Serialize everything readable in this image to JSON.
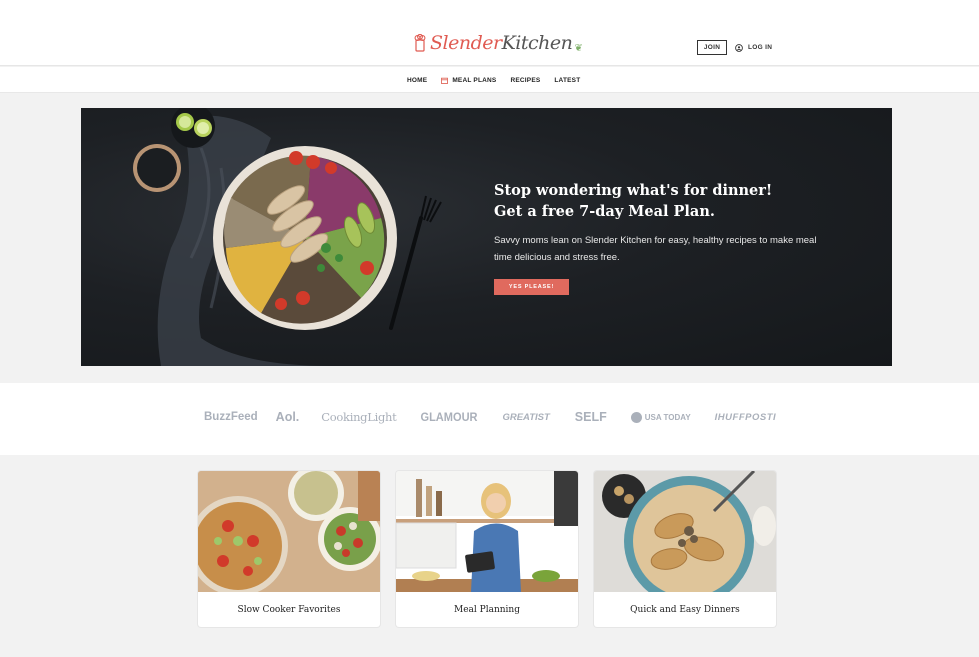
{
  "header": {
    "logo": {
      "part1": "Slender",
      "part2": "Kitchen"
    },
    "join_label": "JOIN",
    "login_label": "LOG IN"
  },
  "nav": {
    "items": [
      {
        "label": "HOME"
      },
      {
        "label": "MEAL PLANS",
        "icon": "calendar-icon"
      },
      {
        "label": "RECIPES"
      },
      {
        "label": "LATEST"
      }
    ]
  },
  "hero": {
    "title_line1": "Stop wondering what's for dinner!",
    "title_line2": "Get a free 7-day Meal Plan.",
    "subtitle": "Savvy moms lean on Slender Kitchen for easy, healthy recipes to make meal time delicious and stress free.",
    "cta_label": "YES PLEASE!"
  },
  "press": {
    "logos": [
      "BuzzFeed",
      "Aol.",
      "CookingLight",
      "GLAMOUR",
      "GREATIST",
      "SELF",
      "USA TODAY",
      "IHUFFPOSTI"
    ]
  },
  "cards": [
    {
      "label": "Slow Cooker Favorites"
    },
    {
      "label": "Meal Planning"
    },
    {
      "label": "Quick and Easy Dinners"
    }
  ],
  "colors": {
    "accent": "#e06a5e",
    "hero_bg": "#1c1f23",
    "press_logo": "#aab0ba"
  }
}
